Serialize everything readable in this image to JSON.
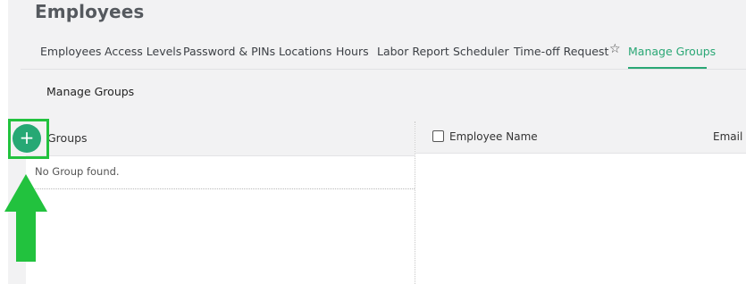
{
  "page": {
    "title": "Employees"
  },
  "tabs": [
    {
      "label": "Employees"
    },
    {
      "label": "Access Levels"
    },
    {
      "label": "Password & PINs"
    },
    {
      "label": "Locations"
    },
    {
      "label": "Hours"
    },
    {
      "label": "Labor Report"
    },
    {
      "label": "Scheduler"
    },
    {
      "label": "Time-off Request"
    },
    {
      "label": "Manage Groups",
      "active": true
    }
  ],
  "section": {
    "title": "Manage Groups"
  },
  "groups": {
    "header": "Groups",
    "empty_message": "No Group found.",
    "add_button_icon": "plus-icon"
  },
  "employees_table": {
    "columns": [
      "Employee Name",
      "Email"
    ]
  },
  "annotation": {
    "highlight_color": "#22c23e",
    "arrow_color": "#22c23e"
  },
  "colors": {
    "accent": "#2aa775",
    "background": "#f2f2f3"
  }
}
